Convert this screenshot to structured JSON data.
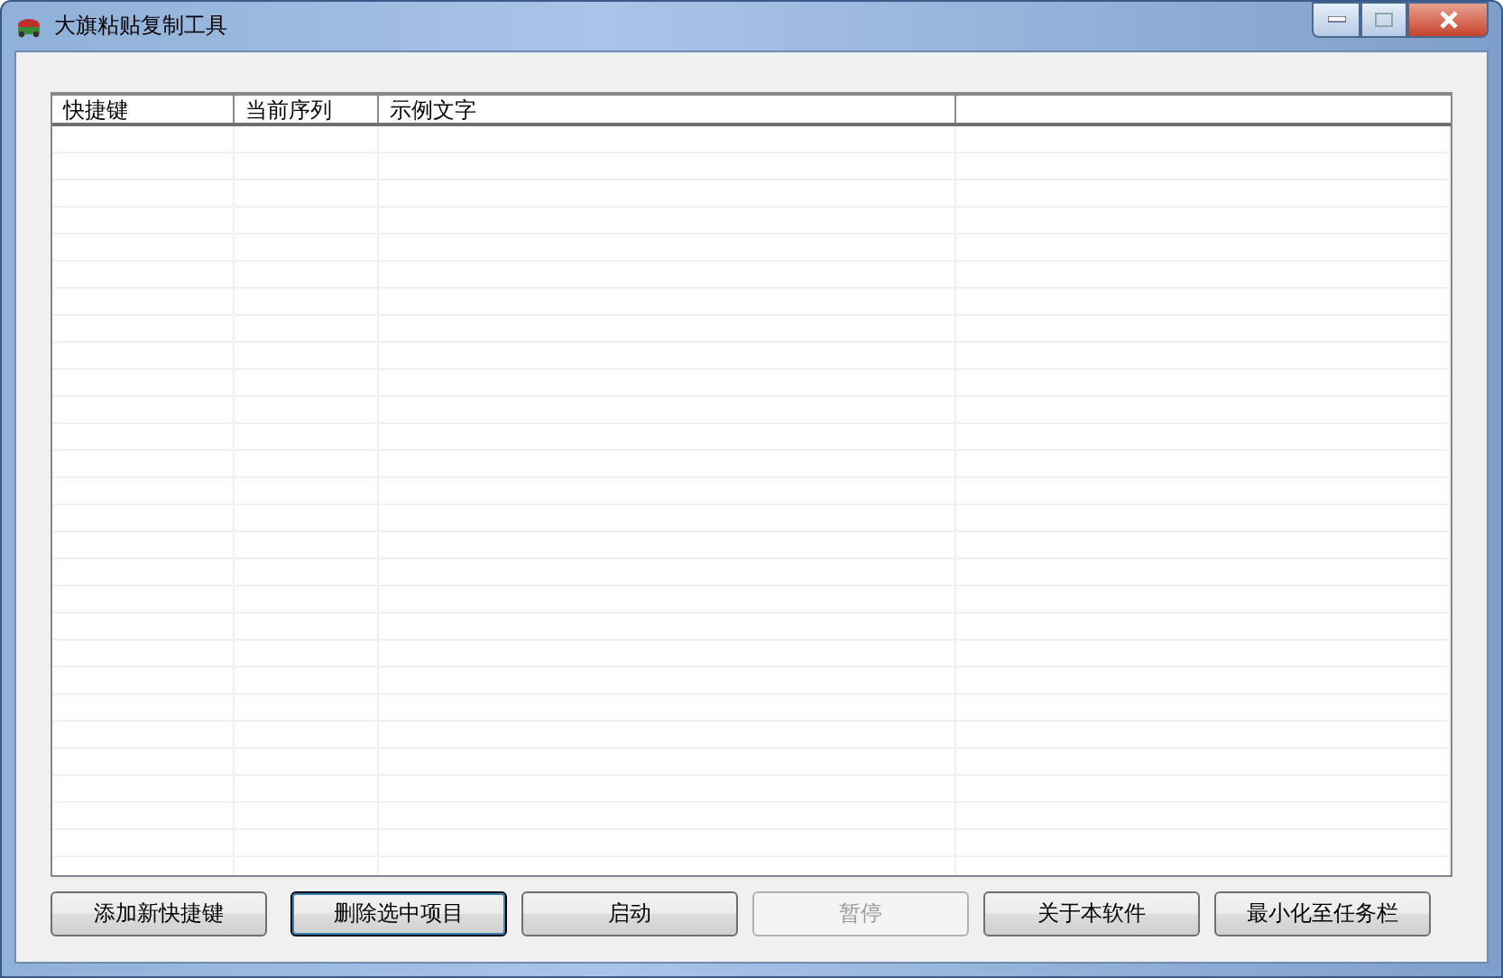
{
  "window": {
    "title": "大旗粘贴复制工具"
  },
  "list": {
    "columns": [
      "快捷键",
      "当前序列",
      "示例文字"
    ]
  },
  "buttons": [
    {
      "label": "添加新快捷键",
      "disabled": false,
      "focused": false
    },
    {
      "label": "删除选中项目",
      "disabled": false,
      "focused": true
    },
    {
      "label": "启动",
      "disabled": false,
      "focused": false
    },
    {
      "label": "暂停",
      "disabled": true,
      "focused": false
    },
    {
      "label": "关于本软件",
      "disabled": false,
      "focused": false
    },
    {
      "label": "最小化至任务栏",
      "disabled": false,
      "focused": false
    }
  ]
}
